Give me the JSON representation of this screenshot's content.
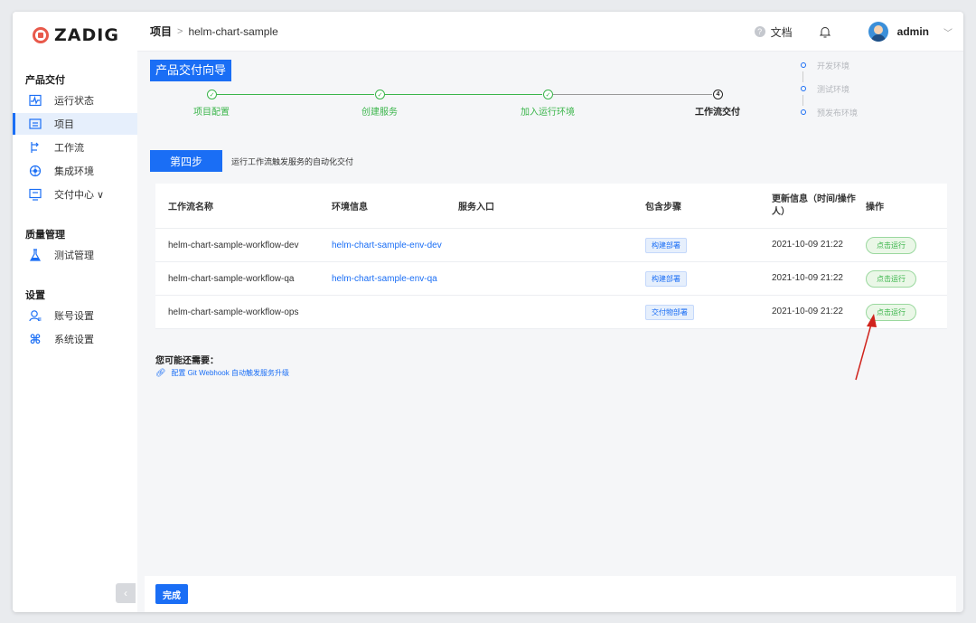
{
  "brand": {
    "logo_text": "ZADIG",
    "accent": "#1a6ef5",
    "success": "#3ab54a"
  },
  "sidebar": {
    "sections": [
      {
        "title": "产品交付",
        "items": [
          {
            "label": "运行状态",
            "icon": "activity-icon"
          },
          {
            "label": "项目",
            "icon": "project-icon",
            "active": true
          },
          {
            "label": "工作流",
            "icon": "workflow-icon"
          },
          {
            "label": "集成环境",
            "icon": "environment-icon"
          },
          {
            "label": "交付中心 ∨",
            "icon": "delivery-icon"
          }
        ]
      },
      {
        "title": "质量管理",
        "items": [
          {
            "label": "测试管理",
            "icon": "test-icon"
          }
        ]
      },
      {
        "title": "设置",
        "items": [
          {
            "label": "账号设置",
            "icon": "account-icon"
          },
          {
            "label": "系统设置",
            "icon": "system-icon"
          }
        ]
      }
    ],
    "collapse_label": "‹"
  },
  "header": {
    "breadcrumb_root": "项目",
    "breadcrumb_sep": ">",
    "breadcrumb_current": "helm-chart-sample",
    "doc_label": "文档",
    "user_name": "admin"
  },
  "guide": {
    "title": "产品交付向导",
    "steps": [
      {
        "label": "项目配置",
        "state": "done"
      },
      {
        "label": "创建服务",
        "state": "done"
      },
      {
        "label": "加入运行环境",
        "state": "done"
      },
      {
        "label": "工作流交付",
        "state": "current",
        "number": "4"
      }
    ],
    "env_legend": [
      "开发环境",
      "测试环境",
      "预发布环境"
    ]
  },
  "step_tag": "第四步",
  "step_desc": "运行工作流触发服务的自动化交付",
  "table": {
    "headers": [
      "工作流名称",
      "环境信息",
      "服务入口",
      "包含步骤",
      "更新信息（时间/操作人）",
      "操作"
    ],
    "rows": [
      {
        "name": "helm-chart-sample-workflow-dev",
        "env": "helm-chart-sample-env-dev",
        "entry": "",
        "steps": "构建部署",
        "updated": "2021-10-09 21:22",
        "action": "点击运行"
      },
      {
        "name": "helm-chart-sample-workflow-qa",
        "env": "helm-chart-sample-env-qa",
        "entry": "",
        "steps": "构建部署",
        "updated": "2021-10-09 21:22",
        "action": "点击运行"
      },
      {
        "name": "helm-chart-sample-workflow-ops",
        "env": "",
        "entry": "",
        "steps": "交付物部署",
        "updated": "2021-10-09 21:22",
        "action": "点击运行"
      }
    ]
  },
  "need": {
    "title": "您可能还需要：",
    "link": "配置 Git Webhook 自动触发服务升级"
  },
  "footer": {
    "done_label": "完成"
  }
}
